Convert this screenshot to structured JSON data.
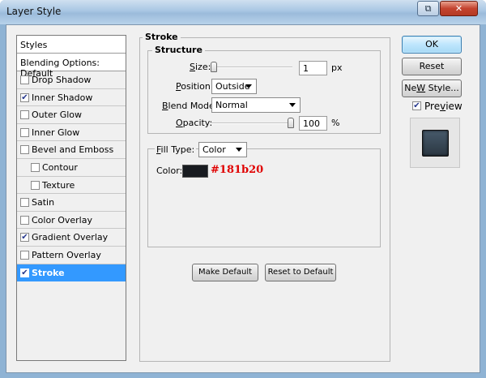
{
  "window": {
    "title": "Layer Style",
    "controls": {
      "restore": "⧉",
      "close": "✕"
    }
  },
  "styles_panel": {
    "header": "Styles",
    "blending": "Blending Options: Default",
    "items": [
      {
        "label": "Drop Shadow",
        "checked": false
      },
      {
        "label": "Inner Shadow",
        "checked": true
      },
      {
        "label": "Outer Glow",
        "checked": false
      },
      {
        "label": "Inner Glow",
        "checked": false
      },
      {
        "label": "Bevel and Emboss",
        "checked": false
      },
      {
        "label": "Contour",
        "checked": false
      },
      {
        "label": "Texture",
        "checked": false
      },
      {
        "label": "Satin",
        "checked": false
      },
      {
        "label": "Color Overlay",
        "checked": false
      },
      {
        "label": "Gradient Overlay",
        "checked": true
      },
      {
        "label": "Pattern Overlay",
        "checked": false
      },
      {
        "label": "Stroke",
        "checked": true
      }
    ],
    "check_glyph": "✔"
  },
  "stroke": {
    "title": "Stroke",
    "structure_title": "Structure",
    "size_label_pre": "",
    "size_label_u": "S",
    "size_label_post": "ize:",
    "size_value": "1",
    "size_unit": "px",
    "position_label_u": "P",
    "position_label_post": "osition:",
    "position_value": "Outside",
    "blend_label_u": "B",
    "blend_label_post": "lend Mode:",
    "blend_value": "Normal",
    "opacity_label_u": "O",
    "opacity_label_post": "pacity:",
    "opacity_value": "100",
    "opacity_unit": "%",
    "fill_type_label_u": "F",
    "fill_type_label_post": "ill Type:",
    "fill_type_value": "Color",
    "color_label": "Color:",
    "color_hex": "#181b20",
    "color_annotation": "#181b20",
    "make_default": "Make Default",
    "reset_default": "Reset to Default"
  },
  "actions": {
    "ok": "OK",
    "reset": "Reset",
    "new_style_u": "W",
    "new_style_pre": "Ne",
    "new_style_post": " Style...",
    "preview_u": "v",
    "preview_pre": "Pre",
    "preview_post": "iew",
    "preview_checked": true
  }
}
